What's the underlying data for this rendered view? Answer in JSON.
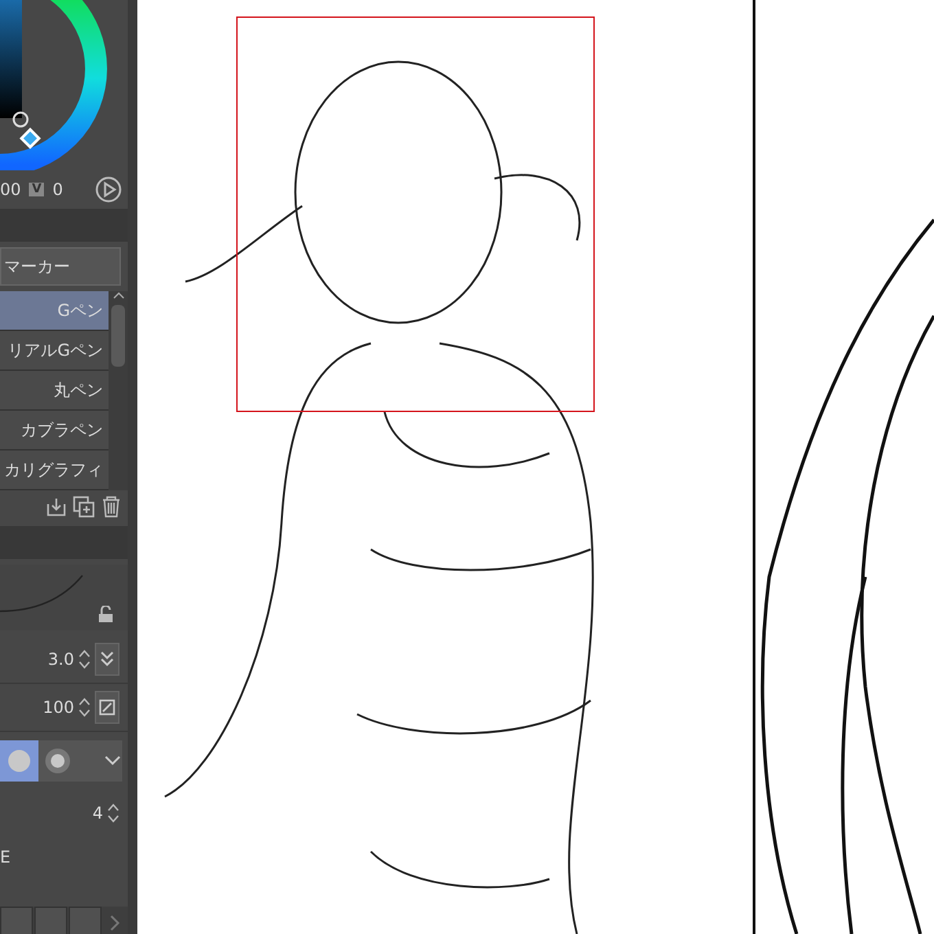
{
  "color_panel": {
    "value_1": "00",
    "badge": "V",
    "value_2": "0"
  },
  "tool_group": {
    "label": "マーカー"
  },
  "brushes": [
    {
      "name": "Gペン",
      "selected": true
    },
    {
      "name": "リアルGペン",
      "selected": false
    },
    {
      "name": "丸ペン",
      "selected": false
    },
    {
      "name": "カブラペン",
      "selected": false
    },
    {
      "name": "カリグラフィ",
      "selected": false
    }
  ],
  "size": {
    "value": "3.0"
  },
  "opacity": {
    "value": "100"
  },
  "brush_tips": [
    {
      "selected": true
    },
    {
      "selected": false
    }
  ],
  "count": {
    "value": "4"
  },
  "partial_label": "E"
}
